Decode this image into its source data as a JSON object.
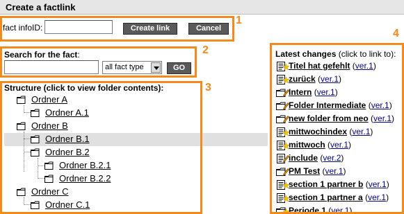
{
  "header": {
    "title": "Create a factlink"
  },
  "form": {
    "fact_label": "fact infoID:",
    "fact_value": "",
    "create_label": "Create link",
    "cancel_label": "Cancel"
  },
  "search": {
    "label": "Search for the fact",
    "colon": ":",
    "value": "",
    "type_selected": "all fact type",
    "go_label": "GO"
  },
  "structure": {
    "heading": "Structure (click to view folder contents):",
    "items": [
      {
        "label": "Ordner A"
      },
      {
        "label": "Ordner A.1"
      },
      {
        "label": "Ordner B"
      },
      {
        "label": "Ordner B.1"
      },
      {
        "label": "Ordner B.2"
      },
      {
        "label": "Ordner B.2.1"
      },
      {
        "label": "Ordner B.2.2"
      },
      {
        "label": "Ordner C"
      },
      {
        "label": "Ordner C.1"
      }
    ]
  },
  "latest": {
    "heading": "Latest changes",
    "subheading": "(click to link to):",
    "items": [
      {
        "name": "Titel hat gefehlt",
        "ver": "ver.1",
        "icon": "document-icon",
        "mark": "star"
      },
      {
        "name": "zurück",
        "ver": "ver.1",
        "icon": "document-icon",
        "mark": "star"
      },
      {
        "name": "Intern",
        "ver": "ver.1",
        "icon": "folder-icon",
        "mark": "pencil"
      },
      {
        "name": "Folder Intermediate",
        "ver": "ver.1",
        "icon": "folder-icon",
        "mark": "pencil"
      },
      {
        "name": "new folder from neo",
        "ver": "ver.1",
        "icon": "folder-icon",
        "mark": "pencil"
      },
      {
        "name": "mittwochindex",
        "ver": "ver.1",
        "icon": "document-icon",
        "mark": "star"
      },
      {
        "name": "mittwoch",
        "ver": "ver.1",
        "icon": "document-icon",
        "mark": "star"
      },
      {
        "name": "include",
        "ver": "ver.2",
        "icon": "document-icon",
        "mark": "pencil"
      },
      {
        "name": "PM Test",
        "ver": "ver.1",
        "icon": "folder-icon",
        "mark": "pencil"
      },
      {
        "name": "section 1 partner b",
        "ver": "ver.1",
        "icon": "document-icon",
        "mark": "star"
      },
      {
        "name": "section 1 partner a",
        "ver": "ver.1",
        "icon": "document-icon",
        "mark": "star"
      },
      {
        "name": "Periode 1",
        "ver": "ver.1",
        "icon": "folder-icon",
        "mark": "star"
      }
    ]
  },
  "annotations": [
    "1",
    "2",
    "3",
    "4"
  ],
  "colors": {
    "accent": "#f08c1e",
    "button": "#5a5a5a",
    "highlight": "#e0e0e0"
  }
}
